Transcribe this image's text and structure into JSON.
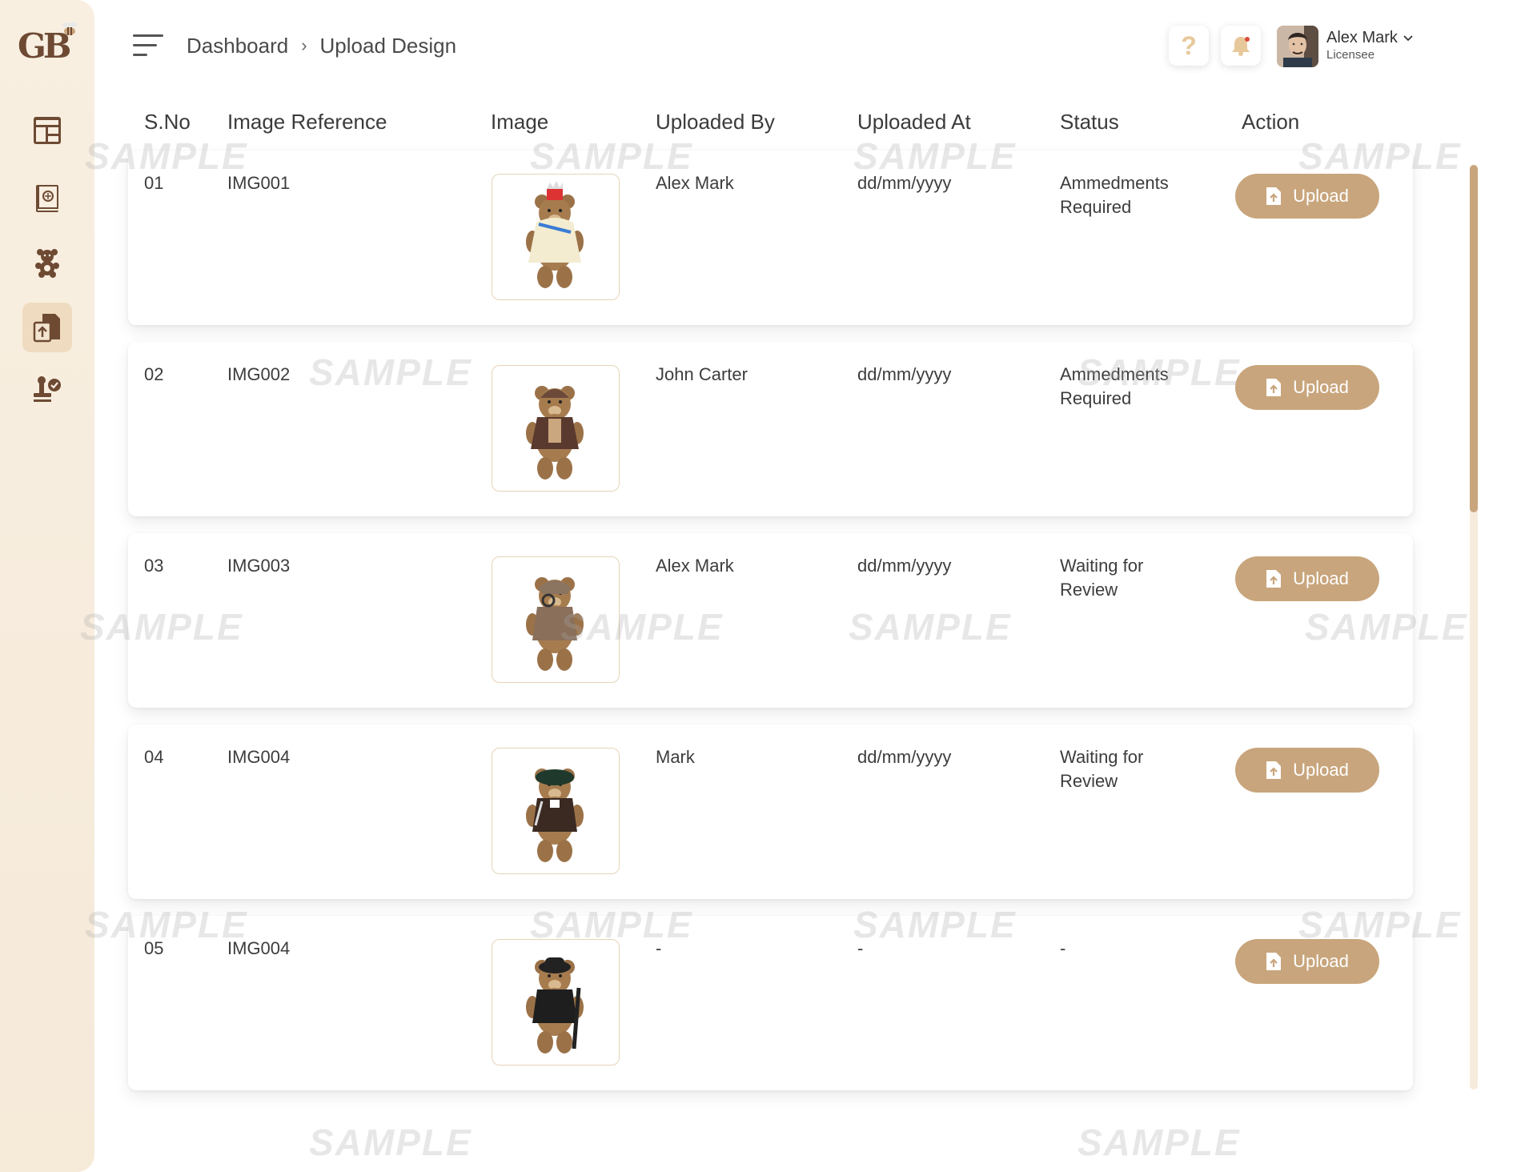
{
  "app": {
    "logo_text": "GB"
  },
  "header": {
    "breadcrumb": [
      "Dashboard",
      "Upload Design"
    ],
    "breadcrumb_sep": "›",
    "help_glyph": "?",
    "user": {
      "name": "Alex Mark",
      "role": "Licensee"
    }
  },
  "sidebar": {
    "items": [
      {
        "icon": "dashboard-icon",
        "active": false
      },
      {
        "icon": "catalog-book-icon",
        "active": false
      },
      {
        "icon": "teddy-bear-icon",
        "active": false
      },
      {
        "icon": "upload-file-icon",
        "active": true
      },
      {
        "icon": "approval-stamp-icon",
        "active": false
      }
    ]
  },
  "table": {
    "headers": [
      "S.No",
      "Image Reference",
      "Image",
      "Uploaded By",
      "Uploaded At",
      "Status",
      "Action"
    ],
    "rows": [
      {
        "sno": "01",
        "ref": "IMG001",
        "by": "Alex Mark",
        "at": "dd/mm/yyyy",
        "status1": "Ammedments",
        "status2": "Required",
        "action": "Upload",
        "bear": "queen"
      },
      {
        "sno": "02",
        "ref": "IMG002",
        "by": "John Carter",
        "at": "dd/mm/yyyy",
        "status1": "Ammedments",
        "status2": "Required",
        "action": "Upload",
        "bear": "pilot"
      },
      {
        "sno": "03",
        "ref": "IMG003",
        "by": "Alex Mark",
        "at": "dd/mm/yyyy",
        "status1": "Waiting for",
        "status2": "Review",
        "action": "Upload",
        "bear": "detective"
      },
      {
        "sno": "04",
        "ref": "IMG004",
        "by": "Mark",
        "at": "dd/mm/yyyy",
        "status1": "Waiting for",
        "status2": "Review",
        "action": "Upload",
        "bear": "scot"
      },
      {
        "sno": "05",
        "ref": "IMG004",
        "by": "-",
        "at": "-",
        "status1": "-",
        "status2": "",
        "action": "Upload",
        "bear": "gentleman"
      }
    ]
  },
  "watermark": "SAMPLE",
  "colors": {
    "accent": "#c8a57c",
    "sidebar_bg": "#f8efe1",
    "icon_brown": "#6e4a33",
    "bell_dot": "#d94c3a"
  }
}
